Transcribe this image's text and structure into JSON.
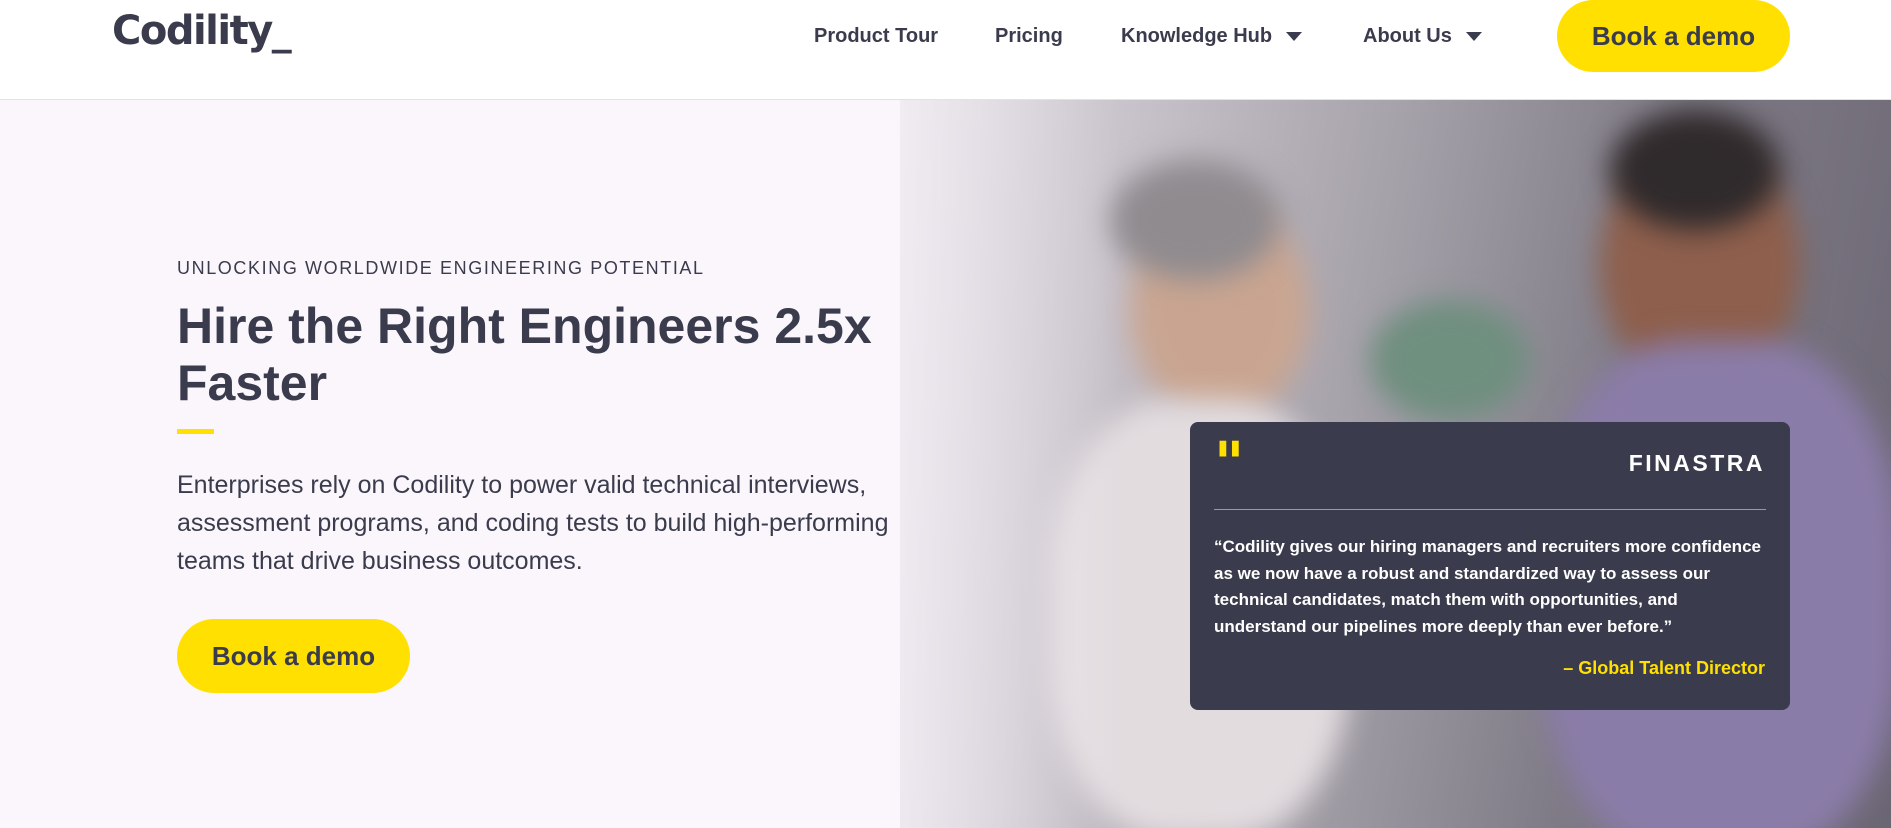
{
  "header": {
    "logo": "Codility_",
    "nav": [
      {
        "label": "Product Tour",
        "has_dropdown": false
      },
      {
        "label": "Pricing",
        "has_dropdown": false
      },
      {
        "label": "Knowledge Hub",
        "has_dropdown": true
      },
      {
        "label": "About Us",
        "has_dropdown": true
      }
    ],
    "cta": "Book a demo"
  },
  "hero": {
    "eyebrow": "UNLOCKING WORLDWIDE ENGINEERING POTENTIAL",
    "headline": "Hire the Right Engineers 2.5x Faster",
    "description": "Enterprises rely on Codility to power valid technical interviews, assessment programs, and coding tests to build high-performing teams that drive business outcomes.",
    "cta": "Book a demo"
  },
  "testimonial": {
    "brand": "FINASTRA",
    "quote": "“Codility gives our hiring managers and recruiters more confidence as we now have a robust and standardized way to assess our technical candidates, match them with opportunities, and understand our pipelines more deeply than ever before.”",
    "attribution": "– Global Talent Director",
    "icon": "quote-icon"
  },
  "colors": {
    "accent": "#ffe000",
    "text": "#3a3b4c",
    "card_bg": "#3a3b4c",
    "hero_bg": "#faf6fc"
  }
}
